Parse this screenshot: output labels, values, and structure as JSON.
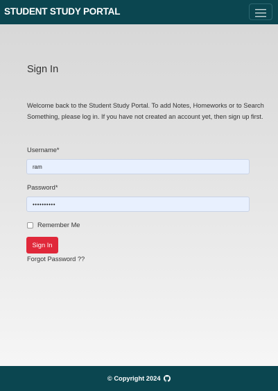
{
  "navbar": {
    "brand": "STUDENT STUDY PORTAL",
    "toggler_icon": "hamburger-menu-icon"
  },
  "login": {
    "title": "Sign In",
    "intro": "Welcome back to the Student Study Portal. To add Notes, Homeworks or to Search Something, please log in. If you have not created an account yet, then sign up first.",
    "username_label": "Username*",
    "username_value": "ram",
    "password_label": "Password*",
    "password_value": "••••••••••",
    "remember_label": "Remember Me",
    "remember_checked": false,
    "submit_label": "Sign In",
    "forgot_label": "Forgot Password ??"
  },
  "footer": {
    "copyright": "© Copyright 2024",
    "icon": "github-icon"
  },
  "colors": {
    "navbar_bg": "#0b4650",
    "button_bg": "#e0283a",
    "input_bg": "#e8f0fe"
  }
}
